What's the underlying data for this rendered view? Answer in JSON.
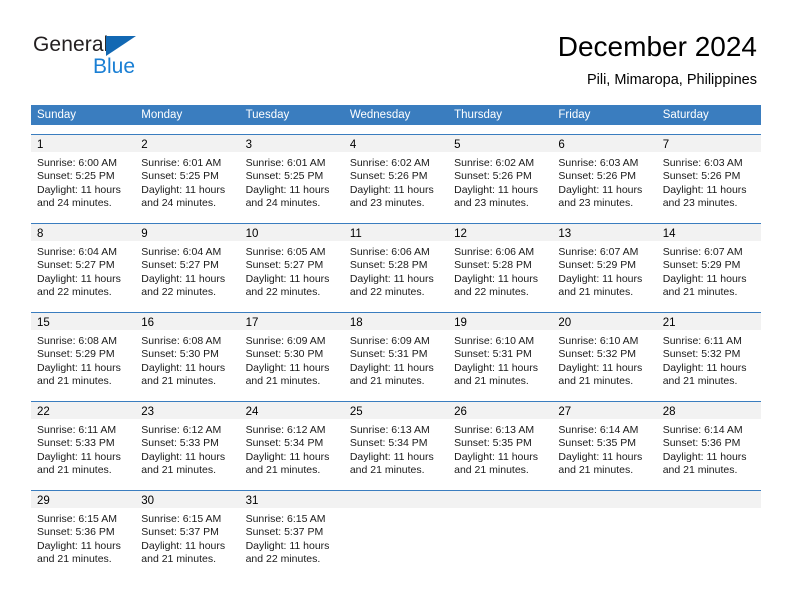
{
  "logo": {
    "word1": "General",
    "word2": "Blue",
    "sail_icon": "sail-triangle-icon",
    "brand_blue": "#1a7fd4",
    "sail_blue": "#1268b3"
  },
  "header": {
    "title": "December 2024",
    "subtitle": "Pili, Mimaropa, Philippines"
  },
  "calendar": {
    "header_color": "#3a7dbf",
    "daynum_band_color": "#f2f2f2",
    "weekdays": [
      "Sunday",
      "Monday",
      "Tuesday",
      "Wednesday",
      "Thursday",
      "Friday",
      "Saturday"
    ],
    "weeks": [
      [
        {
          "day": "1",
          "sunrise": "Sunrise: 6:00 AM",
          "sunset": "Sunset: 5:25 PM",
          "daylight1": "Daylight: 11 hours",
          "daylight2": "and 24 minutes."
        },
        {
          "day": "2",
          "sunrise": "Sunrise: 6:01 AM",
          "sunset": "Sunset: 5:25 PM",
          "daylight1": "Daylight: 11 hours",
          "daylight2": "and 24 minutes."
        },
        {
          "day": "3",
          "sunrise": "Sunrise: 6:01 AM",
          "sunset": "Sunset: 5:25 PM",
          "daylight1": "Daylight: 11 hours",
          "daylight2": "and 24 minutes."
        },
        {
          "day": "4",
          "sunrise": "Sunrise: 6:02 AM",
          "sunset": "Sunset: 5:26 PM",
          "daylight1": "Daylight: 11 hours",
          "daylight2": "and 23 minutes."
        },
        {
          "day": "5",
          "sunrise": "Sunrise: 6:02 AM",
          "sunset": "Sunset: 5:26 PM",
          "daylight1": "Daylight: 11 hours",
          "daylight2": "and 23 minutes."
        },
        {
          "day": "6",
          "sunrise": "Sunrise: 6:03 AM",
          "sunset": "Sunset: 5:26 PM",
          "daylight1": "Daylight: 11 hours",
          "daylight2": "and 23 minutes."
        },
        {
          "day": "7",
          "sunrise": "Sunrise: 6:03 AM",
          "sunset": "Sunset: 5:26 PM",
          "daylight1": "Daylight: 11 hours",
          "daylight2": "and 23 minutes."
        }
      ],
      [
        {
          "day": "8",
          "sunrise": "Sunrise: 6:04 AM",
          "sunset": "Sunset: 5:27 PM",
          "daylight1": "Daylight: 11 hours",
          "daylight2": "and 22 minutes."
        },
        {
          "day": "9",
          "sunrise": "Sunrise: 6:04 AM",
          "sunset": "Sunset: 5:27 PM",
          "daylight1": "Daylight: 11 hours",
          "daylight2": "and 22 minutes."
        },
        {
          "day": "10",
          "sunrise": "Sunrise: 6:05 AM",
          "sunset": "Sunset: 5:27 PM",
          "daylight1": "Daylight: 11 hours",
          "daylight2": "and 22 minutes."
        },
        {
          "day": "11",
          "sunrise": "Sunrise: 6:06 AM",
          "sunset": "Sunset: 5:28 PM",
          "daylight1": "Daylight: 11 hours",
          "daylight2": "and 22 minutes."
        },
        {
          "day": "12",
          "sunrise": "Sunrise: 6:06 AM",
          "sunset": "Sunset: 5:28 PM",
          "daylight1": "Daylight: 11 hours",
          "daylight2": "and 22 minutes."
        },
        {
          "day": "13",
          "sunrise": "Sunrise: 6:07 AM",
          "sunset": "Sunset: 5:29 PM",
          "daylight1": "Daylight: 11 hours",
          "daylight2": "and 21 minutes."
        },
        {
          "day": "14",
          "sunrise": "Sunrise: 6:07 AM",
          "sunset": "Sunset: 5:29 PM",
          "daylight1": "Daylight: 11 hours",
          "daylight2": "and 21 minutes."
        }
      ],
      [
        {
          "day": "15",
          "sunrise": "Sunrise: 6:08 AM",
          "sunset": "Sunset: 5:29 PM",
          "daylight1": "Daylight: 11 hours",
          "daylight2": "and 21 minutes."
        },
        {
          "day": "16",
          "sunrise": "Sunrise: 6:08 AM",
          "sunset": "Sunset: 5:30 PM",
          "daylight1": "Daylight: 11 hours",
          "daylight2": "and 21 minutes."
        },
        {
          "day": "17",
          "sunrise": "Sunrise: 6:09 AM",
          "sunset": "Sunset: 5:30 PM",
          "daylight1": "Daylight: 11 hours",
          "daylight2": "and 21 minutes."
        },
        {
          "day": "18",
          "sunrise": "Sunrise: 6:09 AM",
          "sunset": "Sunset: 5:31 PM",
          "daylight1": "Daylight: 11 hours",
          "daylight2": "and 21 minutes."
        },
        {
          "day": "19",
          "sunrise": "Sunrise: 6:10 AM",
          "sunset": "Sunset: 5:31 PM",
          "daylight1": "Daylight: 11 hours",
          "daylight2": "and 21 minutes."
        },
        {
          "day": "20",
          "sunrise": "Sunrise: 6:10 AM",
          "sunset": "Sunset: 5:32 PM",
          "daylight1": "Daylight: 11 hours",
          "daylight2": "and 21 minutes."
        },
        {
          "day": "21",
          "sunrise": "Sunrise: 6:11 AM",
          "sunset": "Sunset: 5:32 PM",
          "daylight1": "Daylight: 11 hours",
          "daylight2": "and 21 minutes."
        }
      ],
      [
        {
          "day": "22",
          "sunrise": "Sunrise: 6:11 AM",
          "sunset": "Sunset: 5:33 PM",
          "daylight1": "Daylight: 11 hours",
          "daylight2": "and 21 minutes."
        },
        {
          "day": "23",
          "sunrise": "Sunrise: 6:12 AM",
          "sunset": "Sunset: 5:33 PM",
          "daylight1": "Daylight: 11 hours",
          "daylight2": "and 21 minutes."
        },
        {
          "day": "24",
          "sunrise": "Sunrise: 6:12 AM",
          "sunset": "Sunset: 5:34 PM",
          "daylight1": "Daylight: 11 hours",
          "daylight2": "and 21 minutes."
        },
        {
          "day": "25",
          "sunrise": "Sunrise: 6:13 AM",
          "sunset": "Sunset: 5:34 PM",
          "daylight1": "Daylight: 11 hours",
          "daylight2": "and 21 minutes."
        },
        {
          "day": "26",
          "sunrise": "Sunrise: 6:13 AM",
          "sunset": "Sunset: 5:35 PM",
          "daylight1": "Daylight: 11 hours",
          "daylight2": "and 21 minutes."
        },
        {
          "day": "27",
          "sunrise": "Sunrise: 6:14 AM",
          "sunset": "Sunset: 5:35 PM",
          "daylight1": "Daylight: 11 hours",
          "daylight2": "and 21 minutes."
        },
        {
          "day": "28",
          "sunrise": "Sunrise: 6:14 AM",
          "sunset": "Sunset: 5:36 PM",
          "daylight1": "Daylight: 11 hours",
          "daylight2": "and 21 minutes."
        }
      ],
      [
        {
          "day": "29",
          "sunrise": "Sunrise: 6:15 AM",
          "sunset": "Sunset: 5:36 PM",
          "daylight1": "Daylight: 11 hours",
          "daylight2": "and 21 minutes."
        },
        {
          "day": "30",
          "sunrise": "Sunrise: 6:15 AM",
          "sunset": "Sunset: 5:37 PM",
          "daylight1": "Daylight: 11 hours",
          "daylight2": "and 21 minutes."
        },
        {
          "day": "31",
          "sunrise": "Sunrise: 6:15 AM",
          "sunset": "Sunset: 5:37 PM",
          "daylight1": "Daylight: 11 hours",
          "daylight2": "and 22 minutes."
        },
        {
          "day": "",
          "sunrise": "",
          "sunset": "",
          "daylight1": "",
          "daylight2": ""
        },
        {
          "day": "",
          "sunrise": "",
          "sunset": "",
          "daylight1": "",
          "daylight2": ""
        },
        {
          "day": "",
          "sunrise": "",
          "sunset": "",
          "daylight1": "",
          "daylight2": ""
        },
        {
          "day": "",
          "sunrise": "",
          "sunset": "",
          "daylight1": "",
          "daylight2": ""
        }
      ]
    ]
  }
}
